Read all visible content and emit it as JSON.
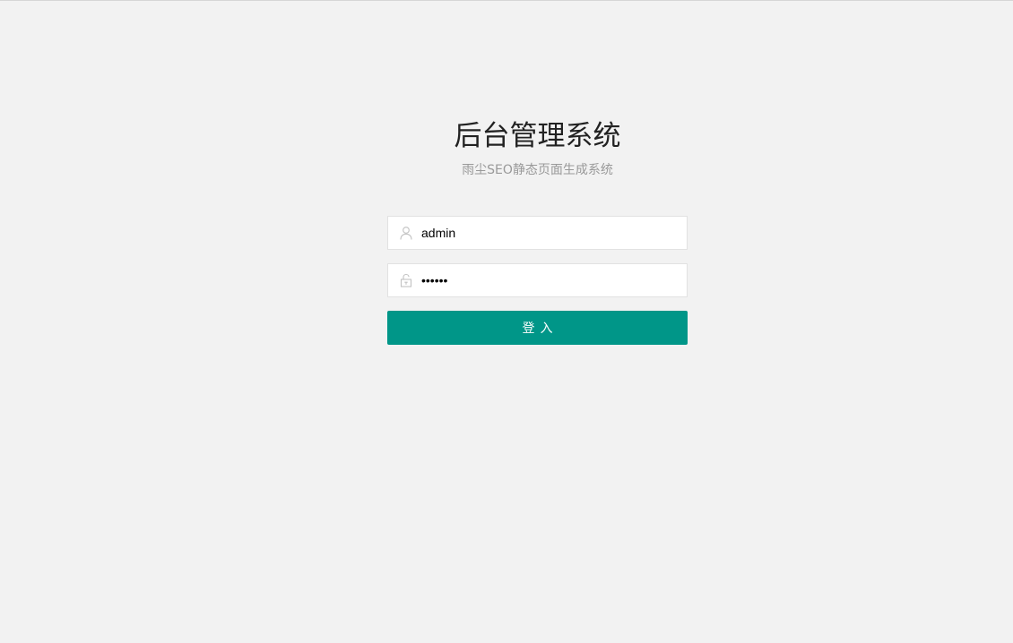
{
  "page": {
    "title": "后台管理系统",
    "subtitle": "雨尘SEO静态页面生成系统"
  },
  "form": {
    "username": {
      "value": "admin",
      "icon": "user-icon"
    },
    "password": {
      "value": "123456",
      "icon": "lock-icon"
    },
    "submit_label": "登入"
  },
  "colors": {
    "background": "#f2f2f2",
    "accent": "#009688",
    "icon": "#c2c2c2"
  }
}
